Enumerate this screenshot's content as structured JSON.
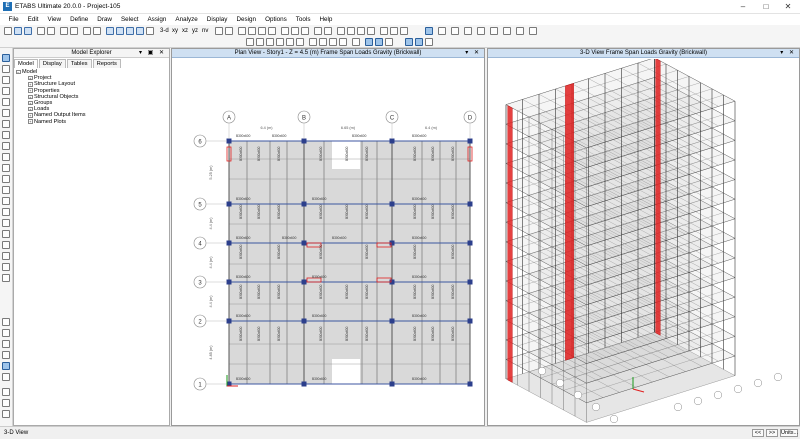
{
  "window": {
    "title": "ETABS Ultimate 20.0.0 - Project-105",
    "logo": "E"
  },
  "menu": [
    "File",
    "Edit",
    "View",
    "Define",
    "Draw",
    "Select",
    "Assign",
    "Analyze",
    "Display",
    "Design",
    "Options",
    "Tools",
    "Help"
  ],
  "toolbar": {
    "view_3d": "3-d",
    "view_xy": "xy",
    "view_xz": "xz",
    "view_yz": "yz",
    "view_nv": "nv"
  },
  "explorer": {
    "title": "Model Explorer",
    "tabs": [
      "Model",
      "Display",
      "Tables",
      "Reports"
    ],
    "root": "Model",
    "items": [
      "Project",
      "Structure Layout",
      "Properties",
      "Structural Objects",
      "Groups",
      "Loads",
      "Named Output Items",
      "Named Plots"
    ]
  },
  "plan_view": {
    "title": "Plan View - Story1 - Z = 4.5 (m)  Frame Span Loads Gravity (Brickwall)",
    "grid_columns": [
      "A",
      "B",
      "C",
      "D"
    ],
    "grid_rows": [
      "6",
      "5",
      "4",
      "3",
      "2",
      "1"
    ],
    "dims_top": [
      "6.4 (m)",
      "6.65 (m)",
      "6.4 (m)"
    ],
    "dims_left": [
      "5.25 (m)",
      "4.4 (m)",
      "4.4 (m)",
      "4.4 (m)",
      "4.85 (m)"
    ],
    "member_label": "B300x600"
  },
  "view_3d": {
    "title": "3-D View  Frame Span Loads Gravity (Brickwall)"
  },
  "status": {
    "text": "3-D View",
    "btn_prev": "<<",
    "btn_next": ">>",
    "btn_units": "Units..."
  },
  "colors": {
    "brace_red": "#e02020",
    "plan_fill": "#d9d9d9",
    "selection_blue": "#9ec4ea"
  }
}
